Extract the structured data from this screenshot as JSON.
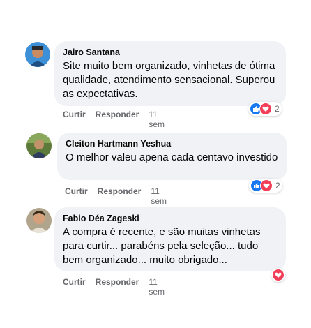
{
  "comments": [
    {
      "author": "Jairo Santana",
      "text": "Site muito bem organizado, vinhetas de ótima qualidade, atendimento sensacional. Superou as expectativas.",
      "like_label": "Curtir",
      "reply_label": "Responder",
      "time": "11 sem",
      "reaction_count": "2",
      "reactions": [
        "like-icon",
        "love-icon"
      ]
    },
    {
      "author": "Cleiton Hartmann Yeshua",
      "text": "O melhor valeu apena cada centavo investido",
      "like_label": "Curtir",
      "reply_label": "Responder",
      "time": "11 sem",
      "reaction_count": "2",
      "reactions": [
        "like-icon",
        "love-icon"
      ]
    },
    {
      "author": "Fabio Déa Zageski",
      "text": "A compra é recente, e são muitas vinhetas para curtir... parabéns pela seleção... tudo bem organizado... muito obrigado...",
      "like_label": "Curtir",
      "reply_label": "Responder",
      "time": "11 sem",
      "reaction_count": "",
      "reactions": [
        "love-icon"
      ]
    }
  ],
  "colors": {
    "bubble": "#f0f2f5",
    "like": "#1877f2",
    "love": "#f33e58",
    "secondary_text": "#65676b"
  }
}
